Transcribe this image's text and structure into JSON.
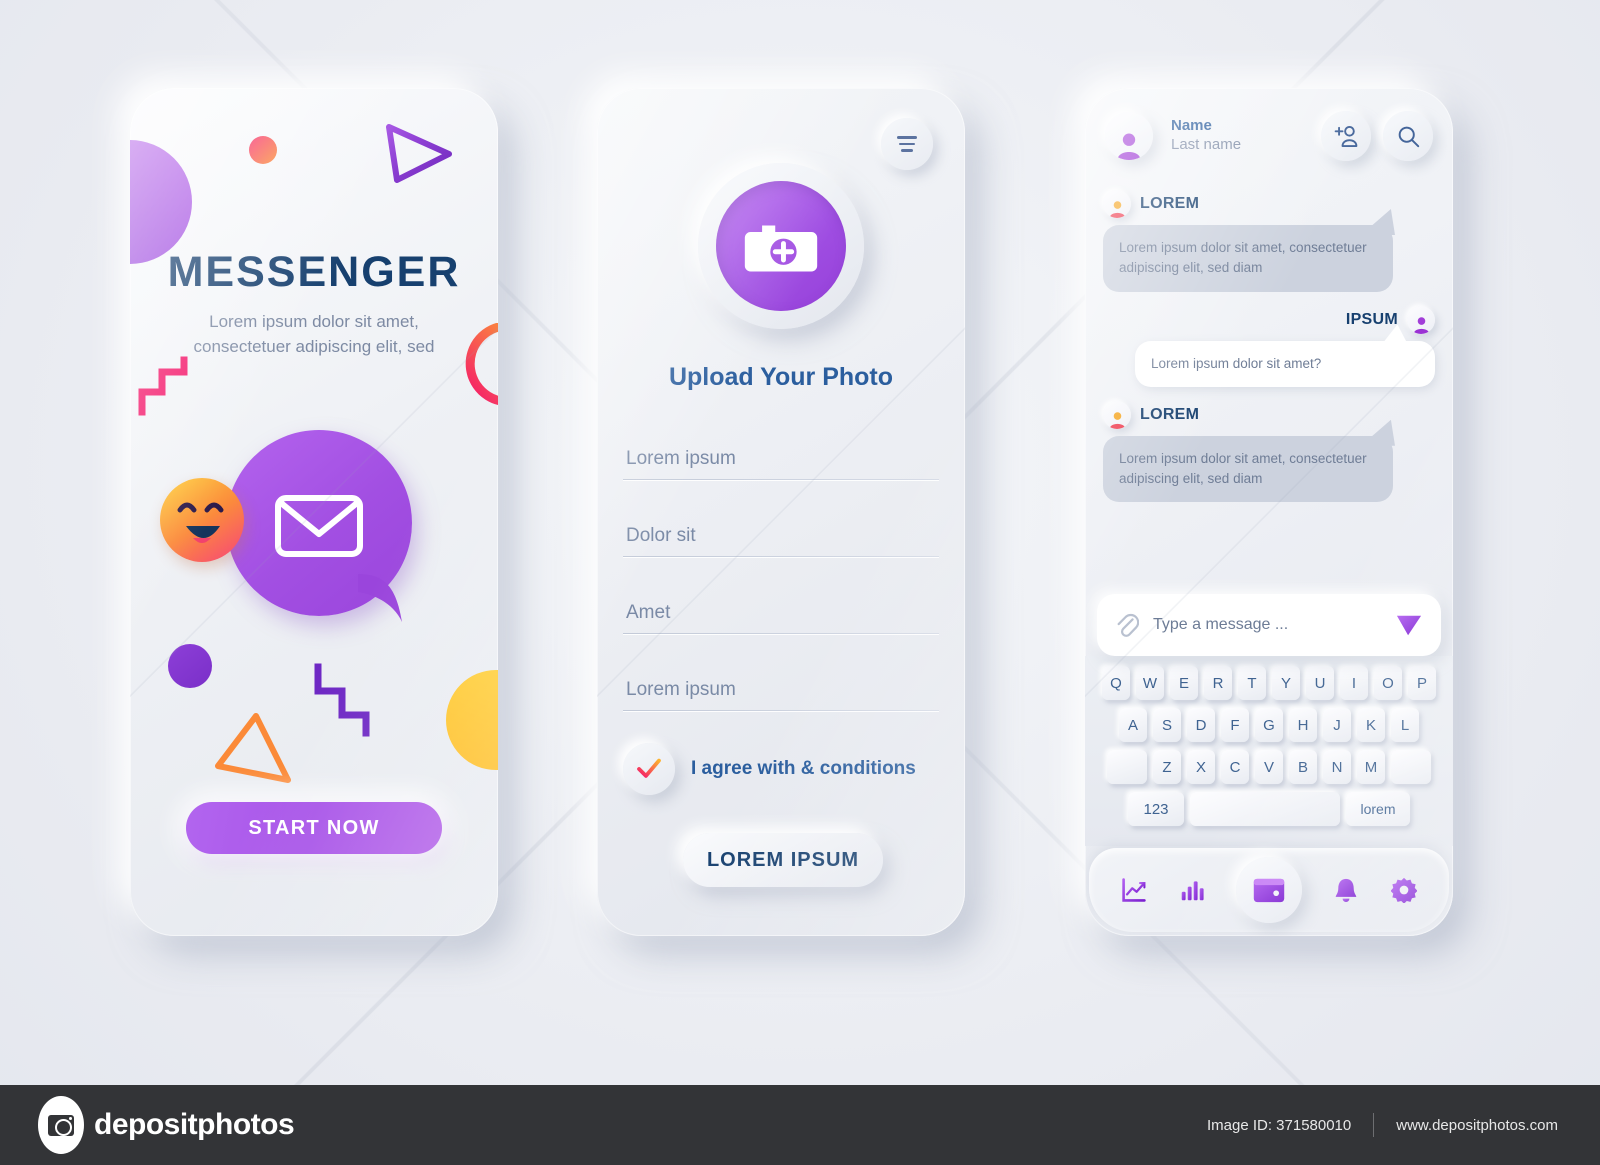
{
  "screen1": {
    "title": "MESSENGER",
    "subtitle": "Lorem ipsum dolor sit amet, consectetuer adipiscing elit, sed",
    "start_button": "START NOW",
    "decor": {
      "halfcircle_purple": "#a84fe0",
      "dot_pink_orange": "#f62a6b",
      "triangle_purple": "#8b3ed2",
      "arc_pink_orange": "#f62a6b",
      "zigzag_pink": "#f4186b",
      "zigzag_purple": "#6e28c4",
      "dot_purple": "#7f31cf",
      "triangle_orange": "#fb8a38",
      "halfcircle_yellow": "#ffc323"
    },
    "bubble_icon": "envelope-icon",
    "emoji_icon": "smiley-emoji"
  },
  "screen2": {
    "menu_icon": "hamburger-menu-icon",
    "camera_icon": "camera-add-icon",
    "title": "Upload Your Photo",
    "fields": [
      {
        "label": "Lorem ipsum"
      },
      {
        "label": "Dolor sit"
      },
      {
        "label": "Amet"
      },
      {
        "label": "Lorem ipsum"
      }
    ],
    "agree_label": "I agree with & conditions",
    "agree_checked": true,
    "submit_button": "LOREM IPSUM"
  },
  "screen3": {
    "header": {
      "name": "Name",
      "last_name": "Last name",
      "add_user_icon": "add-person-icon",
      "search_icon": "search-icon",
      "avatar_icon": "user-avatar"
    },
    "messages": [
      {
        "sender": "LOREM",
        "side": "left",
        "avatar_color": "#f04a56",
        "text": "Lorem ipsum dolor sit amet, consectetuer adipiscing elit, sed diam"
      },
      {
        "sender": "IPSUM",
        "side": "right",
        "avatar_color": "#a23ed8",
        "text": "Lorem ipsum dolor sit amet?"
      },
      {
        "sender": "LOREM",
        "side": "left",
        "avatar_color": "#f04a56",
        "text": "Lorem ipsum dolor sit amet, consectetuer adipiscing elit, sed diam"
      }
    ],
    "input": {
      "placeholder": "Type a message ...",
      "attach_icon": "paperclip-icon",
      "send_icon": "send-paper-plane-icon"
    },
    "keyboard": {
      "row1": [
        "Q",
        "W",
        "E",
        "R",
        "T",
        "Y",
        "U",
        "I",
        "O",
        "P"
      ],
      "row2": [
        "A",
        "S",
        "D",
        "F",
        "G",
        "H",
        "J",
        "K",
        "L"
      ],
      "row3": [
        "Z",
        "X",
        "C",
        "V",
        "B",
        "N",
        "M"
      ],
      "num_key": "123",
      "space_key": "",
      "word_key": "lorem"
    },
    "nav": [
      {
        "icon": "line-chart-icon",
        "active": false
      },
      {
        "icon": "bar-chart-icon",
        "active": false
      },
      {
        "icon": "wallet-icon",
        "active": true
      },
      {
        "icon": "bell-icon",
        "active": false
      },
      {
        "icon": "gear-icon",
        "active": false
      }
    ]
  },
  "footer": {
    "brand": "depositphotos",
    "image_id": "Image ID: 371580010",
    "website": "www.depositphotos.com"
  },
  "colors": {
    "purple": "#a84fe0",
    "dark_blue": "#17406f",
    "muted_blue": "#7d8aa3",
    "bg": "#eef0f4"
  }
}
